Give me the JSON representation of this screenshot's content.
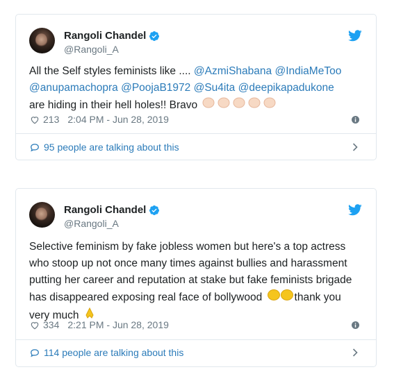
{
  "tweets": [
    {
      "author": "Rangoli Chandel",
      "handle": "@Rangoli_A",
      "text_lines": [
        [
          "All the Self styles feminists like .... ",
          "@AzmiShabana",
          " ",
          "@IndiaMeToo"
        ],
        [
          "@anupamachopra",
          " ",
          "@PoojaB1972",
          " ",
          "@Su4ita",
          " ",
          "@deepikapadukone"
        ],
        [
          "are hiding in their hell holes!! Bravo "
        ]
      ],
      "likes": "213",
      "timestamp": "2:04 PM - Jun 28, 2019",
      "talking": "95 people are talking about this"
    },
    {
      "author": "Rangoli Chandel",
      "handle": "@Rangoli_A",
      "text_lines": [
        "Selective feminism by fake jobless women but here's a top actress",
        "who stoop up not once many times against bullies and harassment",
        "putting her career and reputation at stake but fake feminists brigade",
        "has disappeared exposing real face of bollywood ",
        "very much "
      ],
      "line4_tail": "thank you",
      "likes": "334",
      "timestamp": "2:21 PM - Jun 28, 2019",
      "talking": "114 people are talking about this"
    }
  ],
  "colors": {
    "link": "#2b7bb9",
    "muted": "#697882",
    "border": "#e1e8ed",
    "text": "#1c2022"
  },
  "icons": [
    "twitter-bird-icon",
    "verified-badge-icon",
    "heart-icon",
    "info-icon",
    "comment-bubble-icon",
    "chevron-right-icon",
    "clap-emoji",
    "folded-hands-emoji"
  ]
}
